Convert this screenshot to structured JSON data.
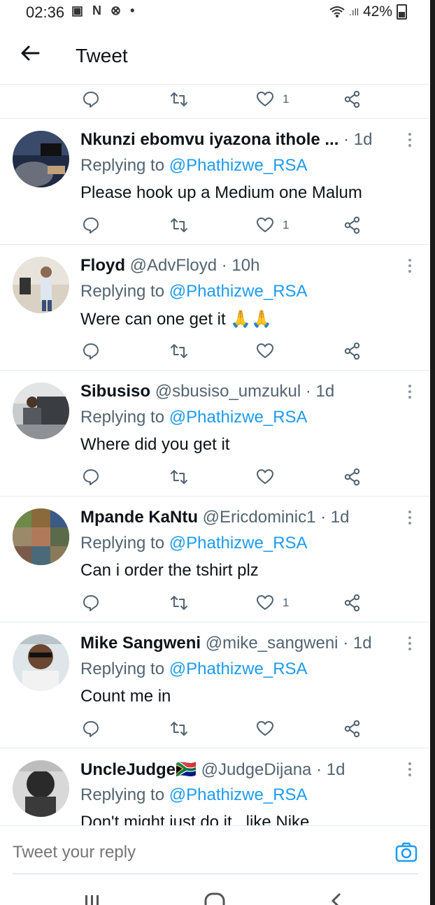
{
  "status_bar": {
    "time": "02:36",
    "notif_icons": "▣ N ⊗ •",
    "battery_pct": "42%"
  },
  "header": {
    "title": "Tweet"
  },
  "top_partial_actions": {
    "likes": "1"
  },
  "tweets": [
    {
      "name": "Nkunzi ebomvu iyazona ithole ...",
      "handle": "",
      "time": "· 1d",
      "replying_prefix": "Replying to ",
      "mention": "@Phathizwe_RSA",
      "text": "Please hook up a Medium one Malum",
      "likes": "1"
    },
    {
      "name": "Floyd",
      "handle": "@AdvFloyd",
      "time": "· 10h",
      "replying_prefix": "Replying to ",
      "mention": "@Phathizwe_RSA",
      "text": "Were can one get it 🙏🙏",
      "likes": ""
    },
    {
      "name": "Sibusiso",
      "handle": "@sbusiso_umzukul",
      "time": "· 1d",
      "replying_prefix": "Replying to ",
      "mention": "@Phathizwe_RSA",
      "text": "Where did you get it",
      "likes": ""
    },
    {
      "name": "Mpande KaNtu",
      "handle": "@Ericdominic1",
      "time": "· 1d",
      "replying_prefix": "Replying to ",
      "mention": "@Phathizwe_RSA",
      "text": "Can i order the tshirt plz",
      "likes": "1"
    },
    {
      "name": "Mike Sangweni",
      "handle": "@mike_sangweni",
      "time": "· 1d",
      "replying_prefix": "Replying to ",
      "mention": "@Phathizwe_RSA",
      "text": "Count me in",
      "likes": ""
    },
    {
      "name": "UncleJudge🇿🇦",
      "handle": "@JudgeDijana",
      "time": "· 1d",
      "replying_prefix": "Replying to ",
      "mention": "@Phathizwe_RSA",
      "text": "Don't might just do it , like Nike",
      "likes": ""
    }
  ],
  "composer": {
    "placeholder": "Tweet your reply"
  },
  "colors": {
    "accent": "#1d9bf0",
    "secondary_text": "#536471",
    "primary_text": "#0f1419",
    "divider": "#e6ecf0"
  },
  "icons": [
    "back-arrow-icon",
    "reply-icon",
    "retweet-icon",
    "like-icon",
    "share-icon",
    "more-icon",
    "camera-icon"
  ]
}
